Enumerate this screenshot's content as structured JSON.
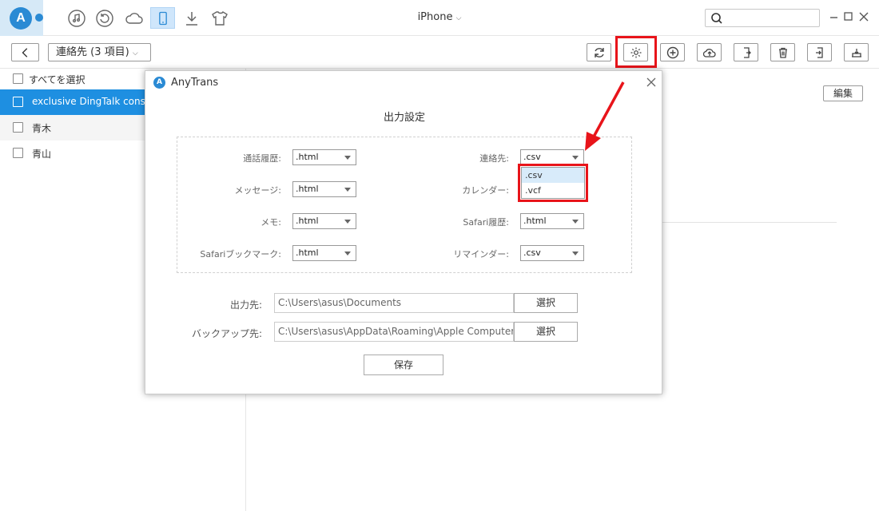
{
  "titlebar": {
    "device_name": "iPhone",
    "logo_letter": "A",
    "icons": [
      "music-icon",
      "history-icon",
      "cloud-icon",
      "device-icon",
      "download-icon",
      "tshirt-icon"
    ],
    "window_controls": [
      "minimize-icon",
      "maximize-icon",
      "close-icon"
    ]
  },
  "toolbar": {
    "breadcrumb": "連絡先 (3 項目)",
    "buttons": [
      "refresh-icon",
      "settings-icon",
      "add-icon",
      "upload-icon",
      "export-icon",
      "delete-icon",
      "import-icon",
      "send-to-device-icon"
    ]
  },
  "list": {
    "select_all": "すべてを選択",
    "items": [
      {
        "label": "exclusive DingTalk consultant",
        "selected": true
      },
      {
        "label": "青木",
        "selected": false
      },
      {
        "label": "青山",
        "selected": false
      }
    ]
  },
  "detail": {
    "edit_label": "編集"
  },
  "dialog": {
    "app_name": "AnyTrans",
    "title": "出力設定",
    "settings": [
      {
        "label": "通話履歴:",
        "value": ".html"
      },
      {
        "label": "連絡先:",
        "value": ".csv"
      },
      {
        "label": "メッセージ:",
        "value": ".html"
      },
      {
        "label": "カレンダー:",
        "value": ".csv"
      },
      {
        "label": "メモ:",
        "value": ".html"
      },
      {
        "label": "Safari履歴:",
        "value": ".html"
      },
      {
        "label": "Safariブックマーク:",
        "value": ".html"
      },
      {
        "label": "リマインダー:",
        "value": ".csv"
      }
    ],
    "dropdown_options": [
      ".csv",
      ".vcf"
    ],
    "output_label": "出力先:",
    "output_path": "C:\\Users\\asus\\Documents",
    "backup_label": "バックアップ先:",
    "backup_path": "C:\\Users\\asus\\AppData\\Roaming\\Apple Computer",
    "choose_label": "選択",
    "save_label": "保存"
  },
  "colors": {
    "accent": "#1e8fe1",
    "highlight": "#e8141a"
  }
}
